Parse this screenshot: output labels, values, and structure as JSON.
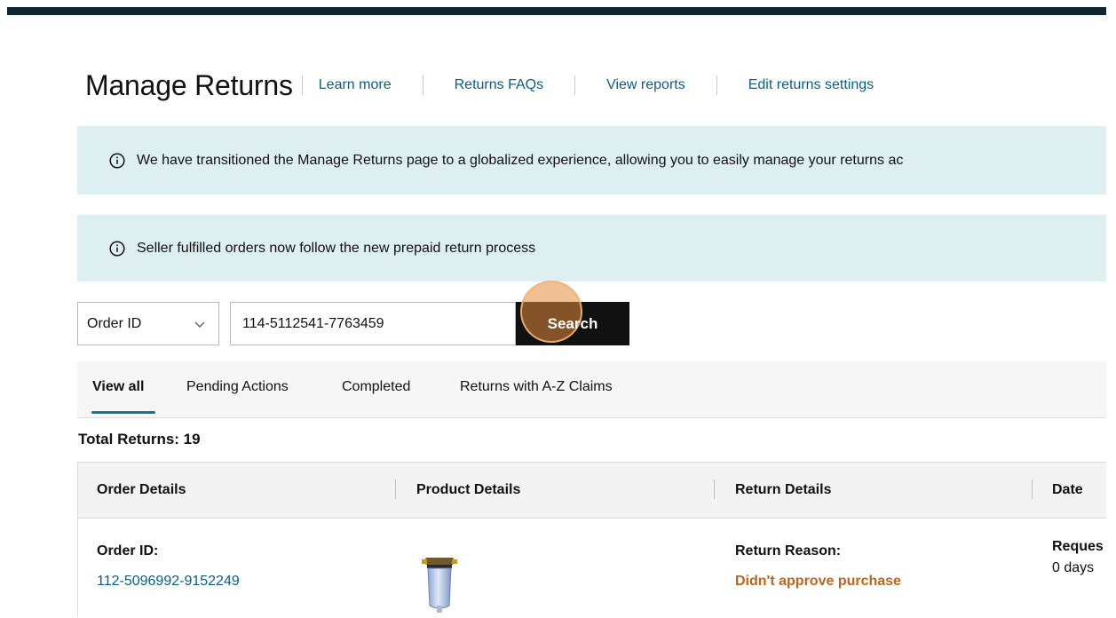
{
  "header": {
    "title": "Manage Returns",
    "links": [
      "Learn more",
      "Returns FAQs",
      "View reports",
      "Edit returns settings"
    ]
  },
  "banners": [
    {
      "icon": "info-icon",
      "text": "We have transitioned the Manage Returns page to a globalized experience, allowing you to easily manage your returns ac"
    },
    {
      "icon": "info-icon",
      "text": "Seller fulfilled orders now follow the new prepaid return process"
    }
  ],
  "search": {
    "field_select": "Order ID",
    "value": "114-5112541-7763459",
    "button_label": "Search"
  },
  "tabs": [
    {
      "label": "View all",
      "active": true
    },
    {
      "label": "Pending Actions",
      "active": false
    },
    {
      "label": "Completed",
      "active": false
    },
    {
      "label": "Returns with A-Z Claims",
      "active": false
    }
  ],
  "total_returns": "Total Returns: 19",
  "table": {
    "columns": [
      "Order Details",
      "Product Details",
      "Return Details",
      "Date"
    ],
    "rows": [
      {
        "order_label": "Order ID:",
        "order_id": "112-5096992-9152249",
        "return_reason_label": "Return Reason:",
        "return_reason": "Didn't approve purchase",
        "date_label": "Reques",
        "date_value": "0 days"
      }
    ]
  },
  "colors": {
    "accent_link": "#0b5f86",
    "banner_bg": "#ddeff1",
    "reason_text": "#b96620",
    "tab_underline": "#0f7b8a"
  }
}
